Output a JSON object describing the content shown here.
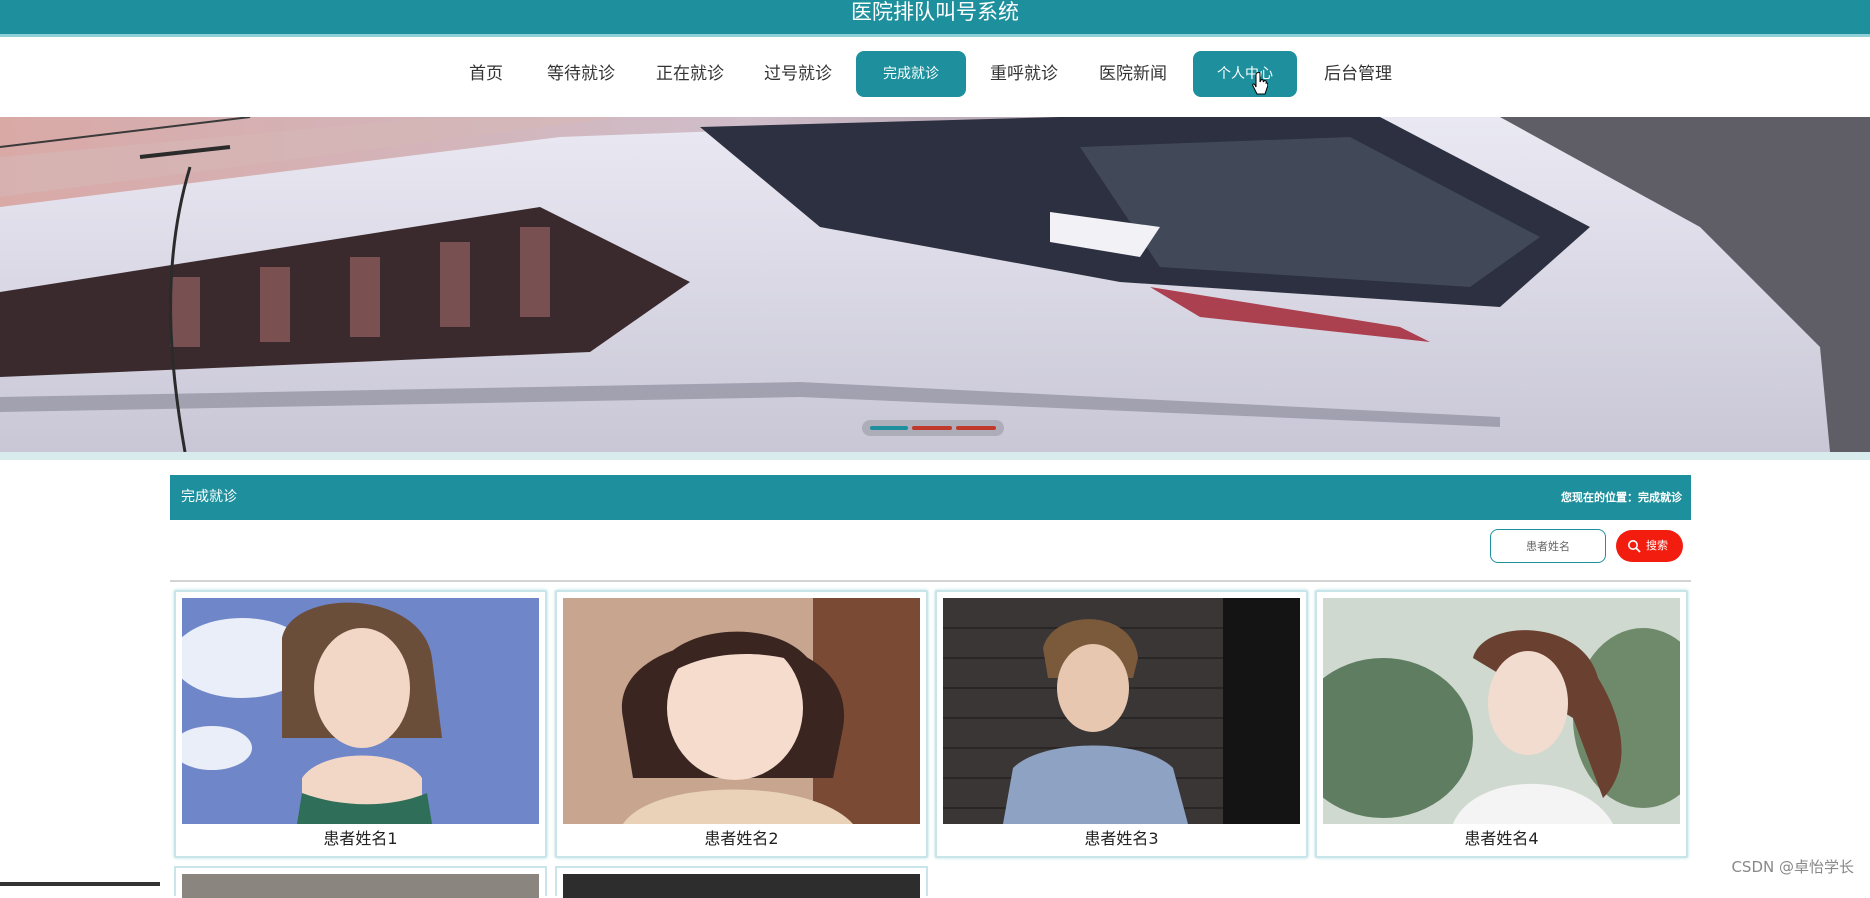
{
  "app": {
    "title": "医院排队叫号系统"
  },
  "nav": {
    "items": [
      {
        "label": "首页",
        "active": false
      },
      {
        "label": "等待就诊",
        "active": false
      },
      {
        "label": "正在就诊",
        "active": false
      },
      {
        "label": "过号就诊",
        "active": false
      },
      {
        "label": "完成就诊",
        "active": true
      },
      {
        "label": "重呼就诊",
        "active": false
      },
      {
        "label": "医院新闻",
        "active": false
      },
      {
        "label": "个人中心",
        "active": true
      },
      {
        "label": "后台管理",
        "active": false
      }
    ]
  },
  "banner": {
    "slide_count": 3,
    "current_slide": 1
  },
  "section": {
    "title": "完成就诊",
    "breadcrumb": "您现在的位置：完成就诊"
  },
  "search": {
    "placeholder": "患者姓名",
    "button_label": "搜索",
    "button_icon": "search-icon"
  },
  "cards": [
    {
      "name": "患者姓名1"
    },
    {
      "name": "患者姓名2"
    },
    {
      "name": "患者姓名3"
    },
    {
      "name": "患者姓名4"
    }
  ],
  "watermark": "CSDN @卓怡学长",
  "colors": {
    "primary": "#1e909d",
    "search_button": "#f21d0f"
  }
}
